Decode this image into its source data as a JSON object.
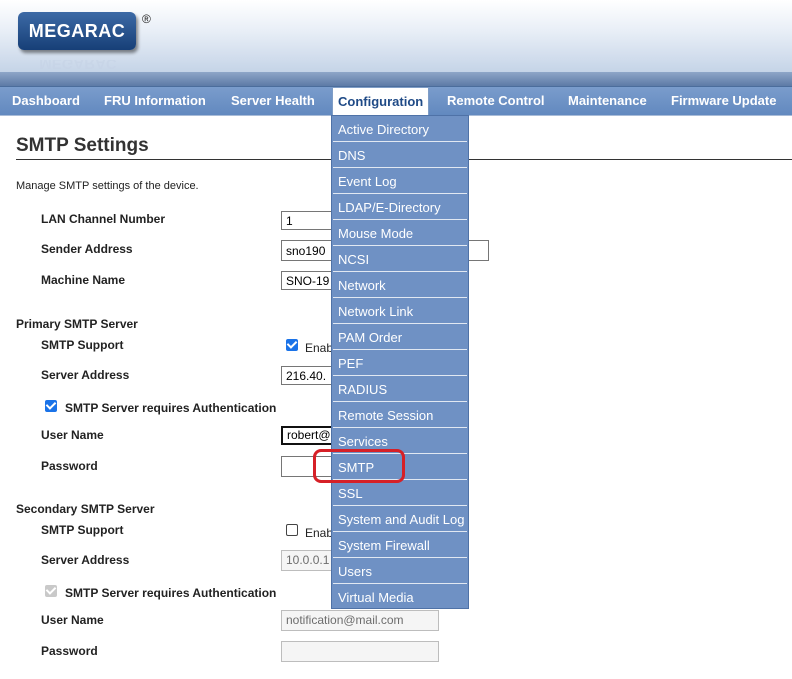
{
  "header": {
    "logo": "MEGARAC",
    "registered": "®"
  },
  "nav": [
    "Dashboard",
    "FRU Information",
    "Server Health",
    "Configuration",
    "Remote Control",
    "Maintenance",
    "Firmware Update"
  ],
  "page": {
    "title": "SMTP Settings",
    "description": "Manage SMTP settings of the device."
  },
  "general": {
    "lan_channel_label": "LAN Channel Number",
    "lan_channel_value": "1",
    "sender_address_label": "Sender Address",
    "sender_address_value": "sno190",
    "machine_name_label": "Machine Name",
    "machine_name_value": "SNO-19"
  },
  "primary": {
    "heading": "Primary SMTP Server",
    "smtp_support_label": "SMTP Support",
    "enable_label": "Enab",
    "server_address_label": "Server Address",
    "server_address_value": "216.40.",
    "auth_label": "SMTP Server requires Authentication",
    "username_label": "User Name",
    "username_value": "robert@",
    "password_label": "Password"
  },
  "secondary": {
    "heading": "Secondary SMTP Server",
    "smtp_support_label": "SMTP Support",
    "enable_label": "Enab",
    "server_address_label": "Server Address",
    "server_address_value": "10.0.0.1",
    "auth_label": "SMTP Server requires Authentication",
    "username_label": "User Name",
    "username_value": "notification@mail.com",
    "password_label": "Password"
  },
  "dropdown": [
    "Active Directory",
    "DNS",
    "Event Log",
    "LDAP/E-Directory",
    "Mouse Mode",
    "NCSI",
    "Network",
    "Network Link",
    "PAM Order",
    "PEF",
    "RADIUS",
    "Remote Session",
    "Services",
    "SMTP",
    "SSL",
    "System and Audit Log",
    "System Firewall",
    "Users",
    "Virtual Media"
  ],
  "colors": {
    "nav_bg": "#6b8fc4",
    "dropdown_bg": "#6f91c4",
    "highlight": "#d62027",
    "checkbox": "#1a73e8"
  }
}
